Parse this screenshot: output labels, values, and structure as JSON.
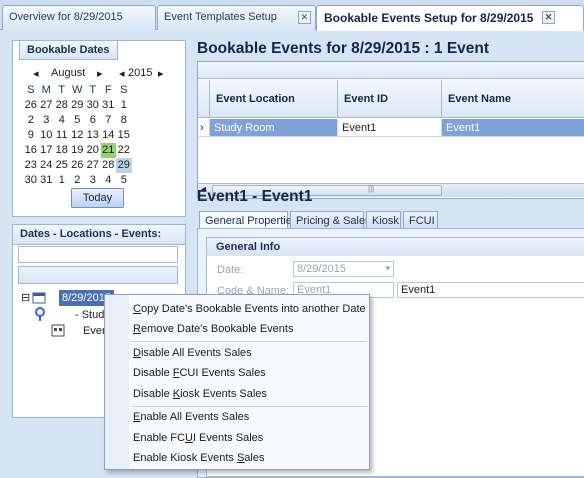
{
  "tabs": [
    {
      "label": "Overview for 8/29/2015"
    },
    {
      "label": "Event Templates Setup"
    },
    {
      "label": "Bookable Events Setup for 8/29/2015"
    }
  ],
  "close_glyph": "✕",
  "left": {
    "bookable_dates_title": "Bookable Dates",
    "calendar": {
      "month": "August",
      "year": "2015",
      "prev_glyph": "◂",
      "next_glyph": "▸",
      "dow": [
        "S",
        "M",
        "T",
        "W",
        "T",
        "F",
        "S"
      ],
      "weeks": [
        [
          "26",
          "27",
          "28",
          "29",
          "30",
          "31",
          "1"
        ],
        [
          "2",
          "3",
          "4",
          "5",
          "6",
          "7",
          "8"
        ],
        [
          "9",
          "10",
          "11",
          "12",
          "13",
          "14",
          "15"
        ],
        [
          "16",
          "17",
          "18",
          "19",
          "20",
          "21",
          "22"
        ],
        [
          "23",
          "24",
          "25",
          "26",
          "27",
          "28",
          "29"
        ],
        [
          "30",
          "31",
          "1",
          "2",
          "3",
          "4",
          "5"
        ]
      ],
      "today_day": "21",
      "selected_day": "29",
      "today_button": "Today"
    },
    "tree_title": "Dates - Locations - Events:",
    "tree": {
      "date_node": "8/29/2015",
      "location_node": "- Study",
      "event_node": "Event",
      "expander_glyph": "⊟"
    }
  },
  "right": {
    "title": "Bookable Events for 8/29/2015  :  1 Event",
    "grid": {
      "columns": [
        "Event Location",
        "Event ID",
        "Event Name"
      ],
      "rows": [
        {
          "indicator": "›",
          "location": "Study Room",
          "id": "Event1",
          "name": "Event1"
        }
      ],
      "scroll_left": "◂",
      "scroll_grip": "|||"
    },
    "detail_title": "Event1  -  Event1",
    "detail_tabs": [
      "General Properties",
      "Pricing & Sales",
      "Kiosk",
      "FCUI"
    ],
    "general_info": {
      "title": "General Info",
      "date_label": "Date:",
      "date_value": "8/29/2015",
      "dropdown_glyph": "▾",
      "code_name_label": "Code & Name:",
      "code_value": "Event1",
      "name_value": "Event1"
    }
  },
  "context_menu": {
    "items": [
      {
        "pre": "",
        "ul": "C",
        "post": "opy Date's Bookable Events into another Date"
      },
      {
        "pre": "",
        "ul": "R",
        "post": "emove Date's Bookable Events"
      },
      {
        "pre": "",
        "ul": "D",
        "post": "isable All Events Sales"
      },
      {
        "pre": "Disable ",
        "ul": "F",
        "post": "CUI Events Sales"
      },
      {
        "pre": "Disable ",
        "ul": "K",
        "post": "iosk Events Sales"
      },
      {
        "pre": "",
        "ul": "E",
        "post": "nable All Events Sales"
      },
      {
        "pre": "Enable FC",
        "ul": "U",
        "post": "I Events Sales"
      },
      {
        "pre": "Enable Kiosk Events ",
        "ul": "S",
        "post": "ales"
      }
    ]
  }
}
